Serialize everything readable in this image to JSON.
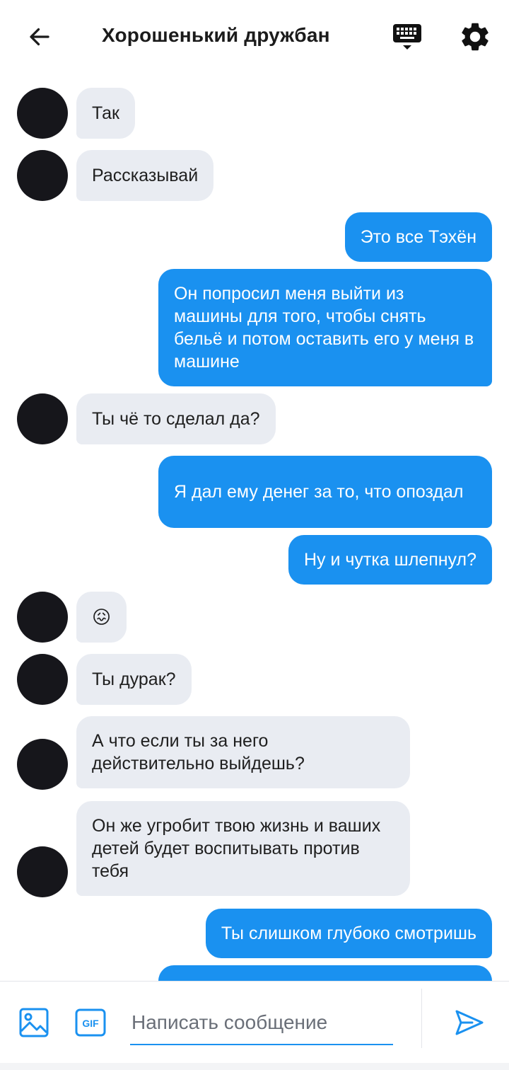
{
  "header": {
    "title": "Хорошенький дружбан",
    "back_icon": "arrow-left-icon",
    "keyboard_icon": "keyboard-icon",
    "settings_icon": "gear-icon"
  },
  "colors": {
    "outgoing_bubble": "#1a91f0",
    "incoming_bubble": "#e9ecf2",
    "accent": "#1a91f0"
  },
  "messages": [
    {
      "from": "them",
      "text": "Так"
    },
    {
      "from": "them",
      "text": "Рассказывай"
    },
    {
      "from": "me",
      "text": "Это все Тэхён"
    },
    {
      "from": "me",
      "text": "Он попросил меня выйти из машины для того, чтобы снять бельё и потом оставить его у меня в машине"
    },
    {
      "from": "them",
      "text": "Ты чё то сделал да?"
    },
    {
      "from": "me",
      "text": "Я дал ему денег за то, что опоздал"
    },
    {
      "from": "me",
      "text": "Ну и чутка шлепнул?"
    },
    {
      "from": "them",
      "text": "😖"
    },
    {
      "from": "them",
      "text": "Ты дурак?"
    },
    {
      "from": "them",
      "text": "А что если ты за него действительно выйдешь?"
    },
    {
      "from": "them",
      "text": "Он же угробит твою жизнь и ваших детей будет воспитывать против тебя"
    },
    {
      "from": "me",
      "text": "Ты слишком глубоко смотришь"
    }
  ],
  "composer": {
    "placeholder": "Написать сообщение",
    "value": "",
    "image_icon": "image-icon",
    "gif_icon": "gif-icon",
    "gif_label": "GIF",
    "send_icon": "send-icon"
  }
}
